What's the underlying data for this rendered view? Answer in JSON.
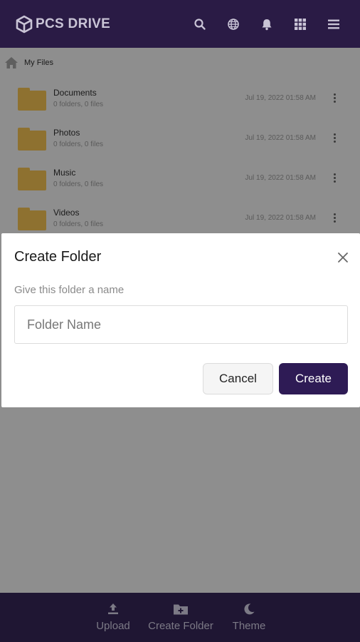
{
  "header": {
    "brand": "PCS DRIVE",
    "icons": [
      "search-icon",
      "globe-icon",
      "bell-icon",
      "grid-icon",
      "menu-icon"
    ]
  },
  "breadcrumb": {
    "label": "My Files"
  },
  "files": [
    {
      "name": "Documents",
      "meta": "0 folders, 0 files",
      "date": "Jul 19, 2022 01:58 AM"
    },
    {
      "name": "Photos",
      "meta": "0 folders, 0 files",
      "date": "Jul 19, 2022 01:58 AM"
    },
    {
      "name": "Music",
      "meta": "0 folders, 0 files",
      "date": "Jul 19, 2022 01:58 AM"
    },
    {
      "name": "Videos",
      "meta": "0 folders, 0 files",
      "date": "Jul 19, 2022 01:58 AM"
    }
  ],
  "modal": {
    "title": "Create Folder",
    "label": "Give this folder a name",
    "input_placeholder": "Folder Name",
    "input_value": "",
    "cancel_label": "Cancel",
    "create_label": "Create"
  },
  "bottom_nav": {
    "upload_label": "Upload",
    "create_folder_label": "Create Folder",
    "theme_label": "Theme"
  },
  "colors": {
    "header_bg": "#2a1b45",
    "primary_button": "#2e1b55",
    "folder": "#e8b84a",
    "bottom_bar": "#1f1633"
  }
}
